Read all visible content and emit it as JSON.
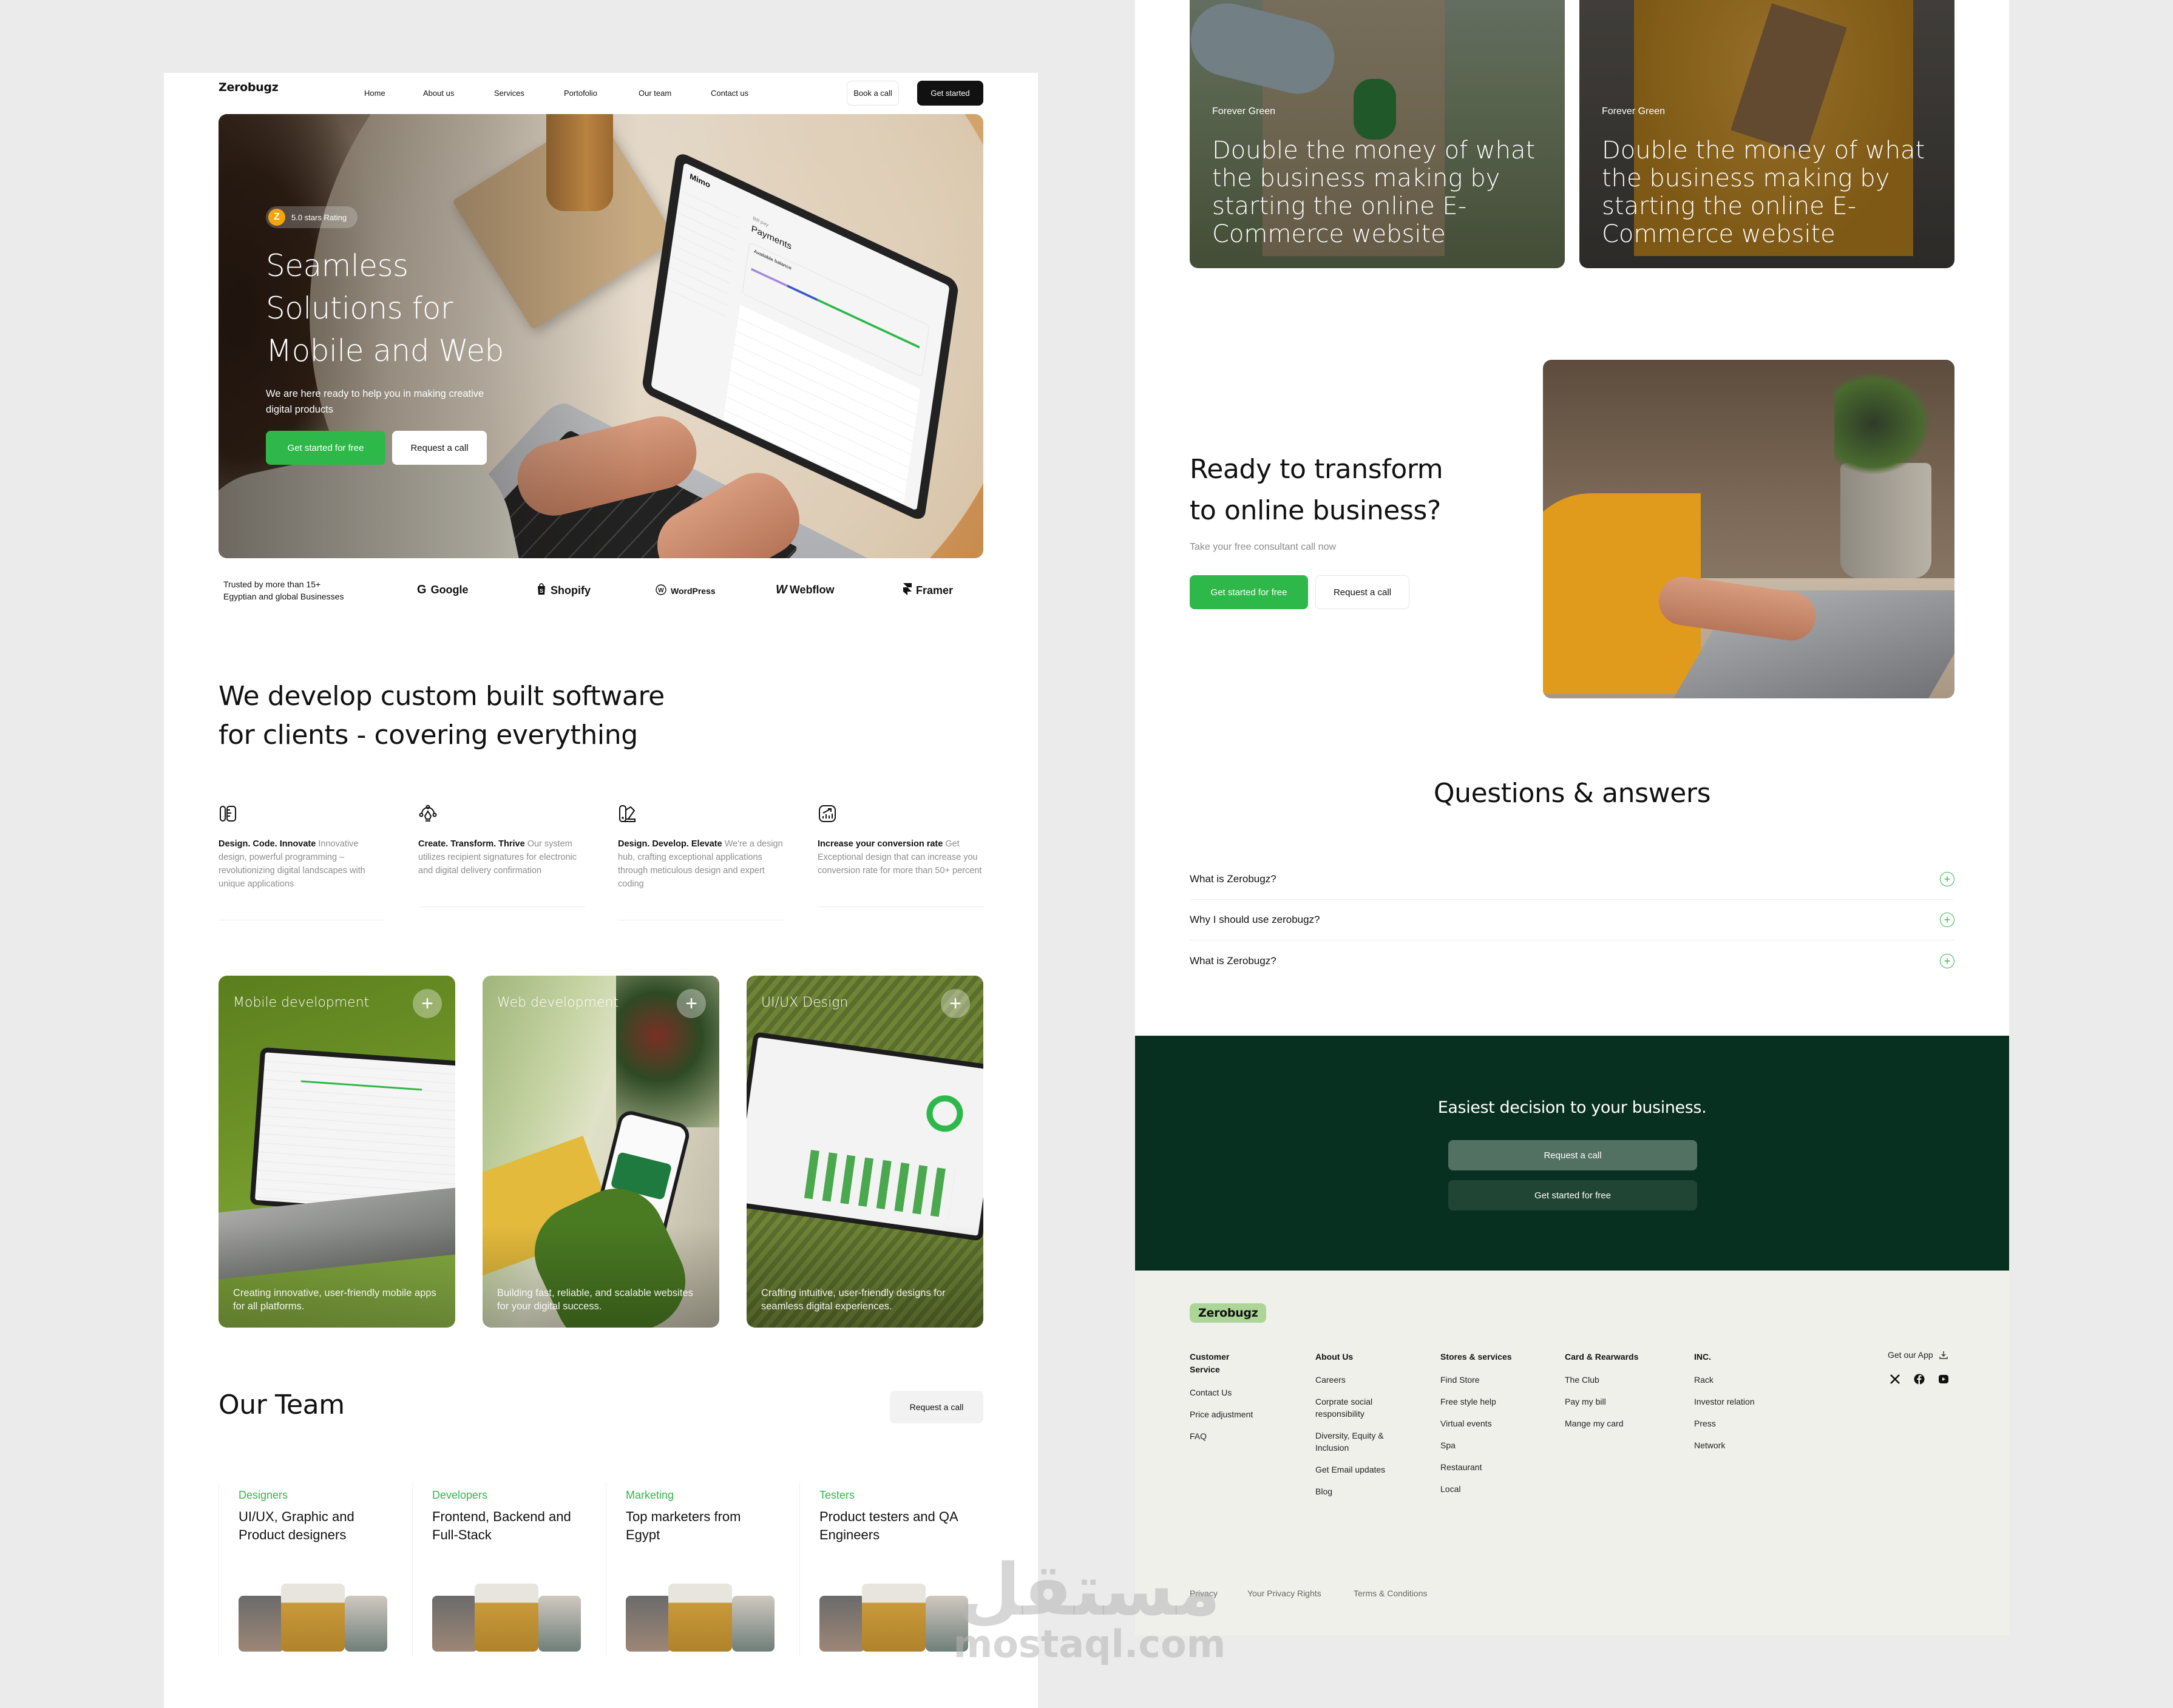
{
  "nav": {
    "logo": "Zerobugz",
    "links": [
      "Home",
      "About us",
      "Services",
      "Portofolio",
      "Our team",
      "Contact us"
    ],
    "book_call": "Book a call",
    "get_started": "Get started"
  },
  "hero": {
    "rating_badge": "Z",
    "rating_text": "5.0 stars Rating",
    "title_lines": [
      "Seamless",
      "Solutions for",
      "Mobile and Web"
    ],
    "subtitle": "We are here ready to help you in making creative digital products",
    "cta_primary": "Get started for free",
    "cta_secondary": "Request a call",
    "laptop_app": {
      "brand": "Mimo",
      "page": "Payments",
      "section": "Bill pay",
      "card_title": "Available balance"
    }
  },
  "trusted": {
    "text_line1": "Trusted by more than 15+",
    "text_line2": "Egyptian and global Businesses",
    "brands": [
      {
        "name": "Google",
        "icon": "google-icon",
        "glyph": "G"
      },
      {
        "name": "Shopify",
        "icon": "shopify-icon",
        "glyph": "🛍"
      },
      {
        "name": "WordPress",
        "icon": "wordpress-icon",
        "glyph": "Ⓦ"
      },
      {
        "name": "Webflow",
        "icon": "webflow-icon",
        "glyph": "W"
      },
      {
        "name": "Framer",
        "icon": "framer-icon",
        "glyph": "F"
      }
    ]
  },
  "intro": {
    "title_line1": "We develop custom built software",
    "title_line2": "for clients - covering everything"
  },
  "features": [
    {
      "icon": "ruler-pencil-icon",
      "title": "Design. Code. Innovate",
      "text": "Innovative design, powerful programming – revolutionizing digital landscapes with unique applications"
    },
    {
      "icon": "vector-pen-icon",
      "title": "Create. Transform. Thrive",
      "text": "Our system utilizes recipient signatures for electronic and digital delivery confirmation"
    },
    {
      "icon": "color-swatch-icon",
      "title": "Design. Develop. Elevate",
      "text": "We're a design hub, crafting exceptional applications through meticulous design and expert coding"
    },
    {
      "icon": "chart-growth-icon",
      "title": "Increase your conversion rate",
      "text": "Get Exceptional design that can increase you conversion rate for more than 50+ percent"
    }
  ],
  "services": [
    {
      "title": "Mobile development",
      "desc": "Creating innovative, user-friendly mobile apps for all platforms."
    },
    {
      "title": "Web development",
      "desc": "Building fast, reliable, and scalable websites for your digital success."
    },
    {
      "title": "UI/UX Design",
      "desc": "Crafting intuitive, user-friendly designs for seamless digital experiences."
    }
  ],
  "team": {
    "title": "Our Team",
    "request_call": "Request a call",
    "groups": [
      {
        "category": "Designers",
        "desc": "UI/UX, Graphic and Product designers"
      },
      {
        "category": "Developers",
        "desc": "Frontend, Backend and Full-Stack"
      },
      {
        "category": "Marketing",
        "desc": "Top marketers from Egypt"
      },
      {
        "category": "Testers",
        "desc": "Product testers and QA Engineers"
      }
    ]
  },
  "stories": [
    {
      "tag": "Forever Green",
      "text": "Double the money of what the business making by starting the online E-Commerce website"
    },
    {
      "tag": "Forever Green",
      "text": "Double the money of what the business making by starting the online E-Commerce website"
    }
  ],
  "transform": {
    "title_line1": "Ready to transform",
    "title_line2": "to online business?",
    "subtitle": "Take your free consultant call now",
    "cta_primary": "Get started for free",
    "cta_secondary": "Request a call"
  },
  "faq": {
    "title": "Questions & answers",
    "items": [
      "What is Zerobugz?",
      "Why I should use zerobugz?",
      "What is Zerobugz?"
    ]
  },
  "cta_banner": {
    "title": "Easiest decision to your business.",
    "request_call": "Request a call",
    "get_started": "Get started for free"
  },
  "footer": {
    "logo": "Zerobugz",
    "columns": [
      {
        "heading_line1": "Customer",
        "heading_line2": "Service",
        "items": [
          "Contact Us",
          "Price adjustment",
          "FAQ"
        ]
      },
      {
        "heading_line1": "About Us",
        "heading_line2": "",
        "items": [
          "Careers",
          "Corprate social responsibility",
          "Diversity, Equity & Inclusion",
          "Get Email updates",
          "Blog"
        ]
      },
      {
        "heading_line1": "Stores & services",
        "heading_line2": "",
        "items": [
          "Find Store",
          "Free style help",
          "Virtual events",
          "Spa",
          "Restaurant",
          "Local"
        ]
      },
      {
        "heading_line1": "Card & Rearwards",
        "heading_line2": "",
        "items": [
          "The Club",
          "Pay my bill",
          "Mange my card"
        ]
      },
      {
        "heading_line1": "INC.",
        "heading_line2": "",
        "items": [
          "Rack",
          "Investor relation",
          "Press",
          "Network"
        ]
      }
    ],
    "get_app": "Get our App",
    "social": [
      "x-icon",
      "facebook-icon",
      "youtube-icon"
    ],
    "legal": [
      "Privacy",
      "Your Privacy Rights",
      "Terms & Conditions"
    ]
  },
  "watermark": {
    "arabic": "مستقل",
    "latin": "mostaql.com"
  },
  "colors": {
    "accent_green": "#2fb84a",
    "dark_green": "#083020",
    "footer_bg": "#f0f0eb",
    "logo_badge": "#acd598",
    "rating_badge": "#f6a40b"
  }
}
